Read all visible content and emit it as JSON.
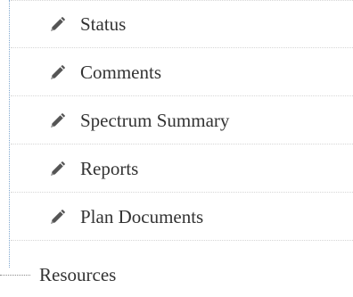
{
  "tree": {
    "children": [
      {
        "label": "Status",
        "icon": "pencil-icon"
      },
      {
        "label": "Comments",
        "icon": "pencil-icon"
      },
      {
        "label": "Spectrum Summary",
        "icon": "pencil-icon"
      },
      {
        "label": "Reports",
        "icon": "pencil-icon"
      },
      {
        "label": "Plan Documents",
        "icon": "pencil-icon"
      }
    ],
    "root": {
      "label": "Resources"
    }
  },
  "colors": {
    "text": "#333333",
    "icon": "#555555",
    "tree_line": "#7fa7cf",
    "separator": "#d6d6d6"
  }
}
